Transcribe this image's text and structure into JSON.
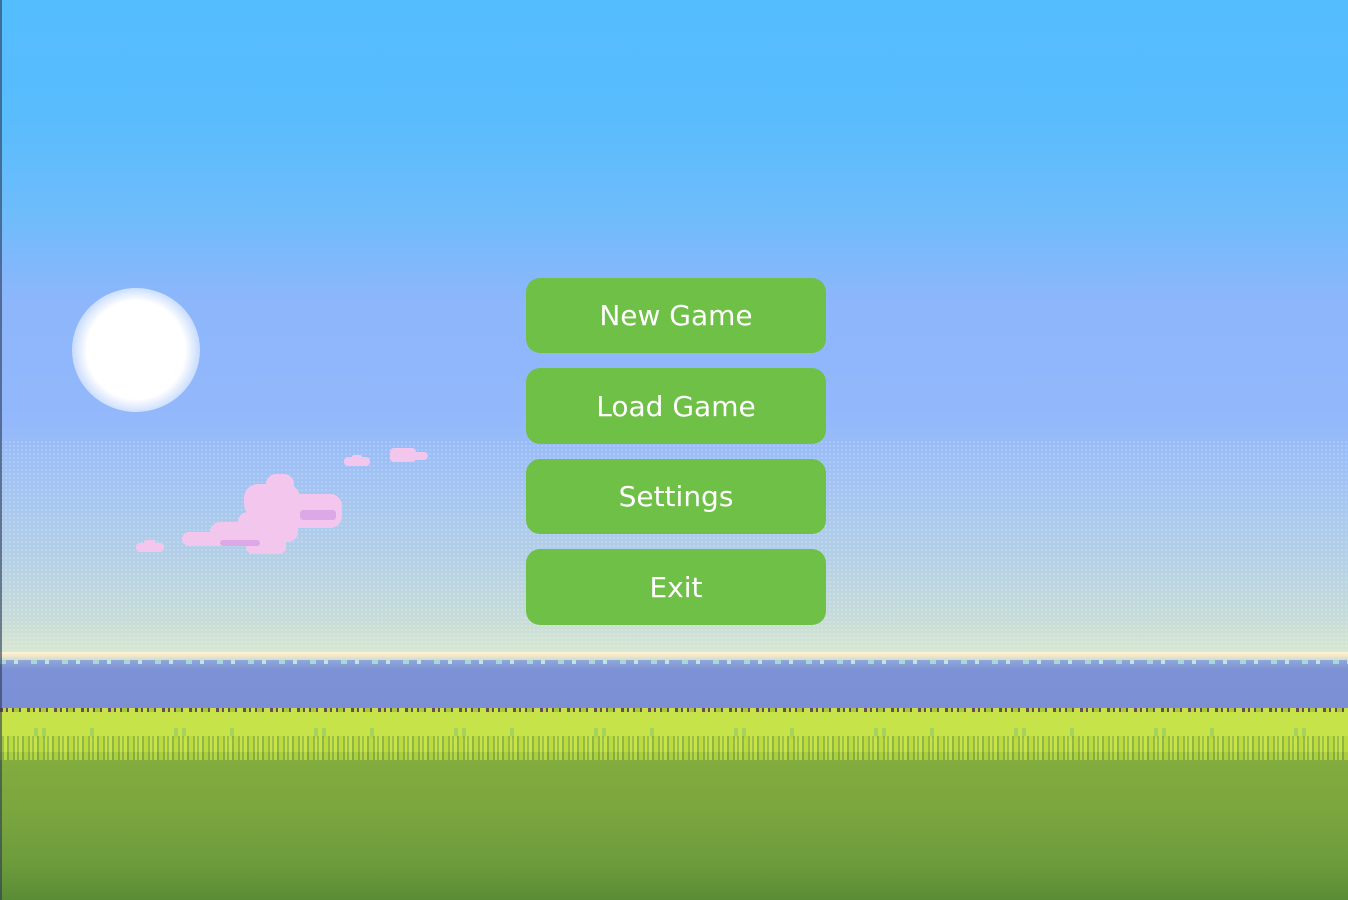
{
  "menu": {
    "items": [
      {
        "label": "New Game"
      },
      {
        "label": "Load Game"
      },
      {
        "label": "Settings"
      },
      {
        "label": "Exit"
      }
    ]
  },
  "scene": {
    "sun-icon": "sun",
    "clouds": "pink pixel clouds",
    "colors": {
      "button": "#6fc046",
      "button_text": "#ffffff",
      "sky_top": "#54bdfe",
      "sky_bottom": "#d6e6d2",
      "water": "#7b8ed6",
      "grass": "#c7e34a",
      "ground": "#5a8c36"
    }
  }
}
